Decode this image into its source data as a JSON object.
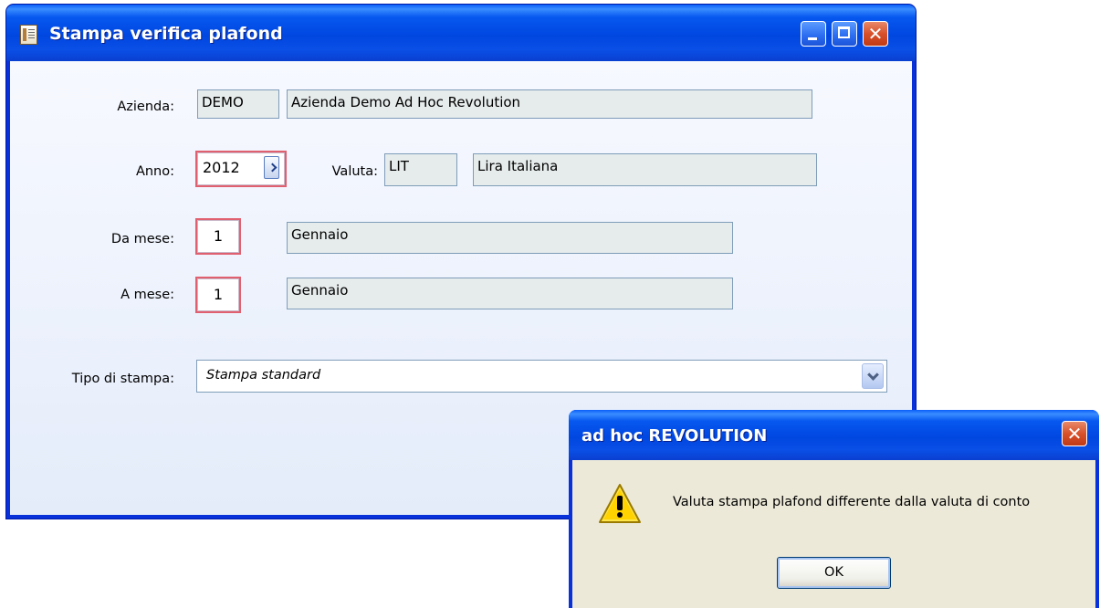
{
  "main_window": {
    "title": "Stampa verifica plafond",
    "icon": "document-icon",
    "form": {
      "azienda_label": "Azienda:",
      "azienda_code": "DEMO",
      "azienda_name": "Azienda Demo Ad Hoc Revolution",
      "anno_label": "Anno:",
      "anno_value": "2012",
      "valuta_label": "Valuta:",
      "valuta_code": "LIT",
      "valuta_name": "Lira Italiana",
      "da_mese_label": "Da mese:",
      "da_mese_value": "1",
      "da_mese_name": "Gennaio",
      "a_mese_label": "A mese:",
      "a_mese_value": "1",
      "a_mese_name": "Gennaio",
      "tipo_stampa_label": "Tipo di stampa:",
      "tipo_stampa_value": "Stampa standard"
    }
  },
  "message_box": {
    "title": "ad hoc REVOLUTION",
    "icon": "warning-icon",
    "text": "Valuta stampa plafond differente dalla valuta di conto",
    "ok_label": "OK"
  },
  "colors": {
    "titlebar_blue": "#0047e0",
    "dialog_face": "#ece9d8",
    "required_border": "#e06070"
  }
}
